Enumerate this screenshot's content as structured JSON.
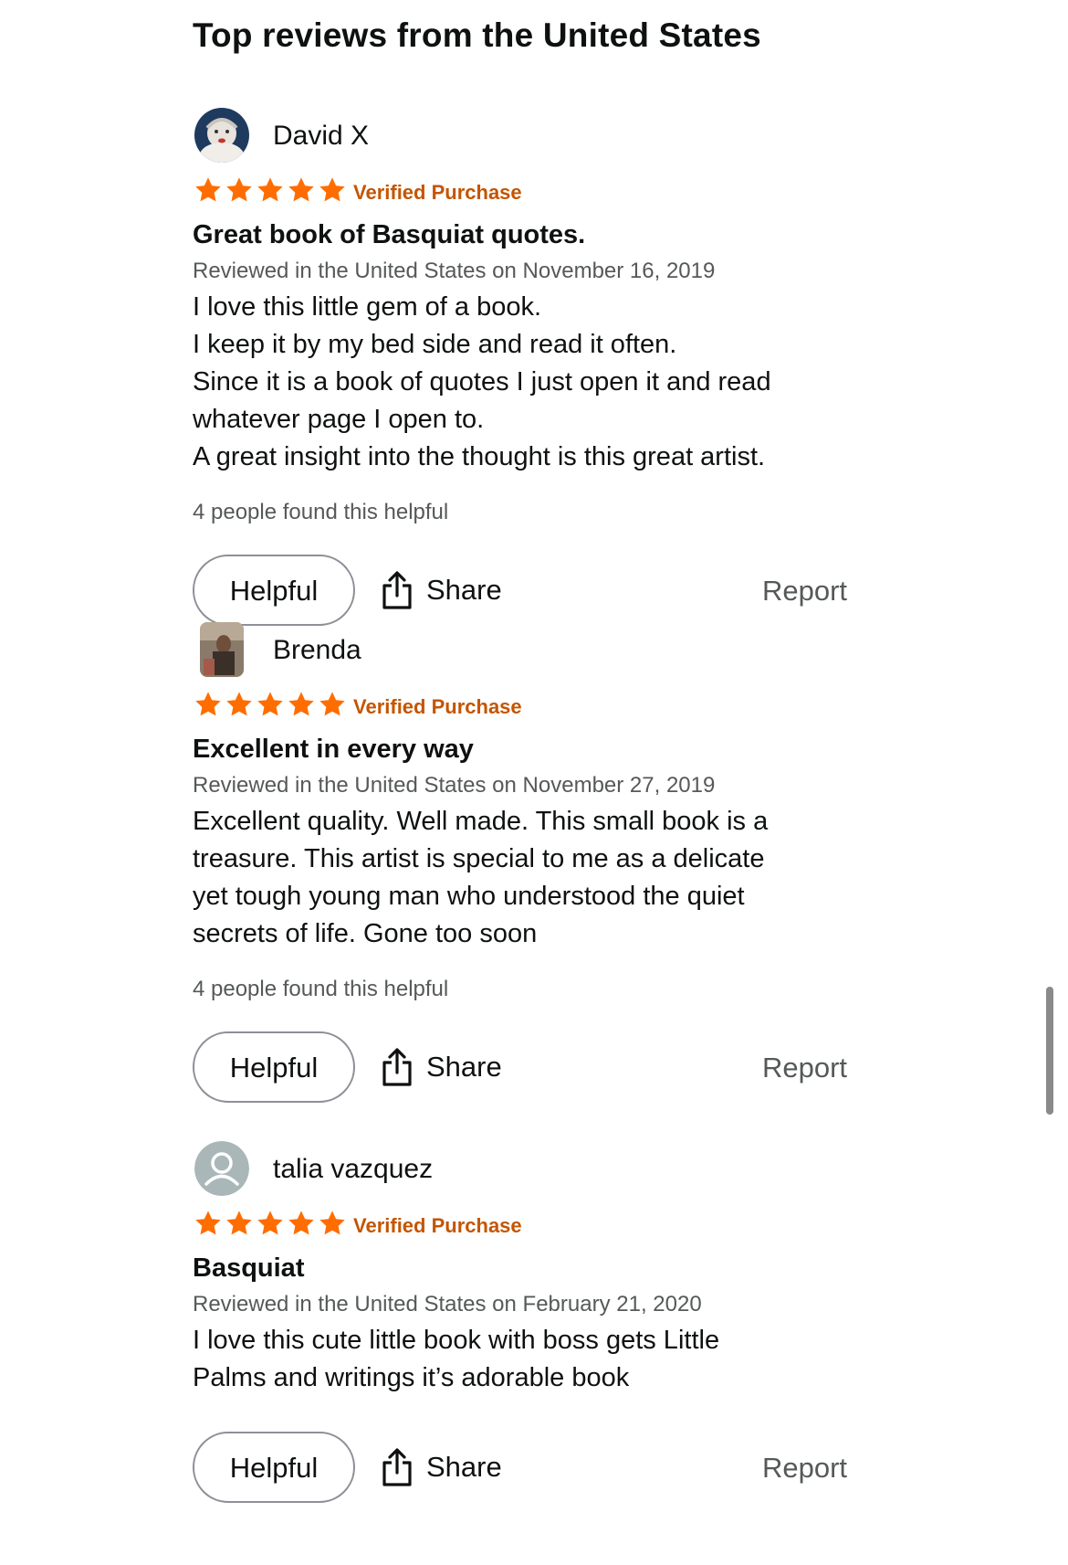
{
  "page": {
    "title": "Top reviews from the United States"
  },
  "colors": {
    "star": "#ff6d00",
    "verified": "#c45500",
    "secondary_text": "#565959",
    "primary_text": "#0f1111"
  },
  "reviews": [
    {
      "reviewer": "David X",
      "avatar": "clown-portrait-avatar",
      "rating": 5,
      "verified": "Verified Purchase",
      "title": "Great book of Basquiat quotes.",
      "date": "Reviewed in the United States on November 16, 2019",
      "body_lines": [
        "I love this little gem of a book.",
        "I keep it by my bed side and read it often.",
        "Since it is a book of quotes I just open it and read",
        "whatever page I open to.",
        "A great insight into the thought is this great artist."
      ],
      "helpful_count": "4 people found this helpful",
      "helpful_label": "Helpful",
      "share_label": "Share",
      "report_label": "Report"
    },
    {
      "reviewer": "Brenda",
      "avatar": "photo-avatar",
      "rating": 5,
      "verified": "Verified Purchase",
      "title": "Excellent in every way",
      "date": "Reviewed in the United States on November 27, 2019",
      "body_lines": [
        "Excellent quality. Well made. This small book is a",
        "treasure. This artist is special to me as a delicate",
        "yet tough young man who understood the quiet",
        "secrets of life. Gone too soon"
      ],
      "helpful_count": "4 people found this helpful",
      "helpful_label": "Helpful",
      "share_label": "Share",
      "report_label": "Report"
    },
    {
      "reviewer": "talia vazquez",
      "avatar": "default-user-avatar",
      "rating": 5,
      "verified": "Verified Purchase",
      "title": "Basquiat",
      "date": "Reviewed in the United States on February 21, 2020",
      "body_lines": [
        "I love this cute little book with boss gets Little",
        "Palms and writings it’s adorable book"
      ],
      "helpful_label": "Helpful",
      "share_label": "Share",
      "report_label": "Report"
    }
  ]
}
